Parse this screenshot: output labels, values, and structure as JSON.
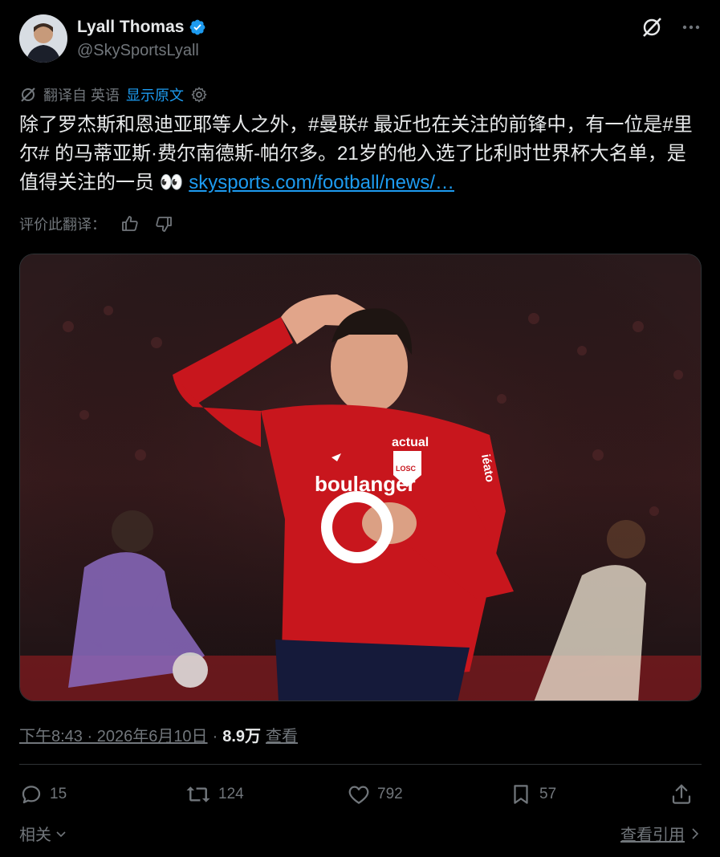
{
  "author": {
    "name": "Lyall Thomas",
    "handle": "@SkySportsLyall",
    "verified": true
  },
  "translation": {
    "translated_from": "翻译自 英语",
    "show_original": "显示原文"
  },
  "tweet": {
    "text_part1": "除了罗杰斯和恩迪亚耶等人之外，",
    "hashtag1": "#曼联#",
    "text_part2": " 最近也在关注的前锋中，有一位是",
    "hashtag2": "#里尔#",
    "text_part3": " 的马蒂亚斯·费尔南德斯-帕尔多。21岁的他入选了比利时世界杯大名单，是值得关注的一员 👀 ",
    "link": "skysports.com/football/news/…"
  },
  "rate_translation": {
    "label": "评价此翻译："
  },
  "media": {
    "alt": "Lille player in red jersey saluting"
  },
  "jersey": {
    "sponsor": "boulanger",
    "brand": "actual",
    "sleeve": "iéato",
    "club": "LOSC"
  },
  "meta": {
    "time": "下午8:43 · 2026年6月10日",
    "separator": "·",
    "views": "8.9万",
    "views_label": "查看"
  },
  "stats": {
    "replies": "15",
    "retweets": "124",
    "likes": "792",
    "bookmarks": "57"
  },
  "footer": {
    "related": "相关",
    "view_quotes": "查看引用"
  },
  "colors": {
    "accent": "#1d9bf0",
    "muted": "#71767b",
    "text": "#e7e9ea",
    "background": "#000000",
    "jersey_red": "#c8161d"
  }
}
